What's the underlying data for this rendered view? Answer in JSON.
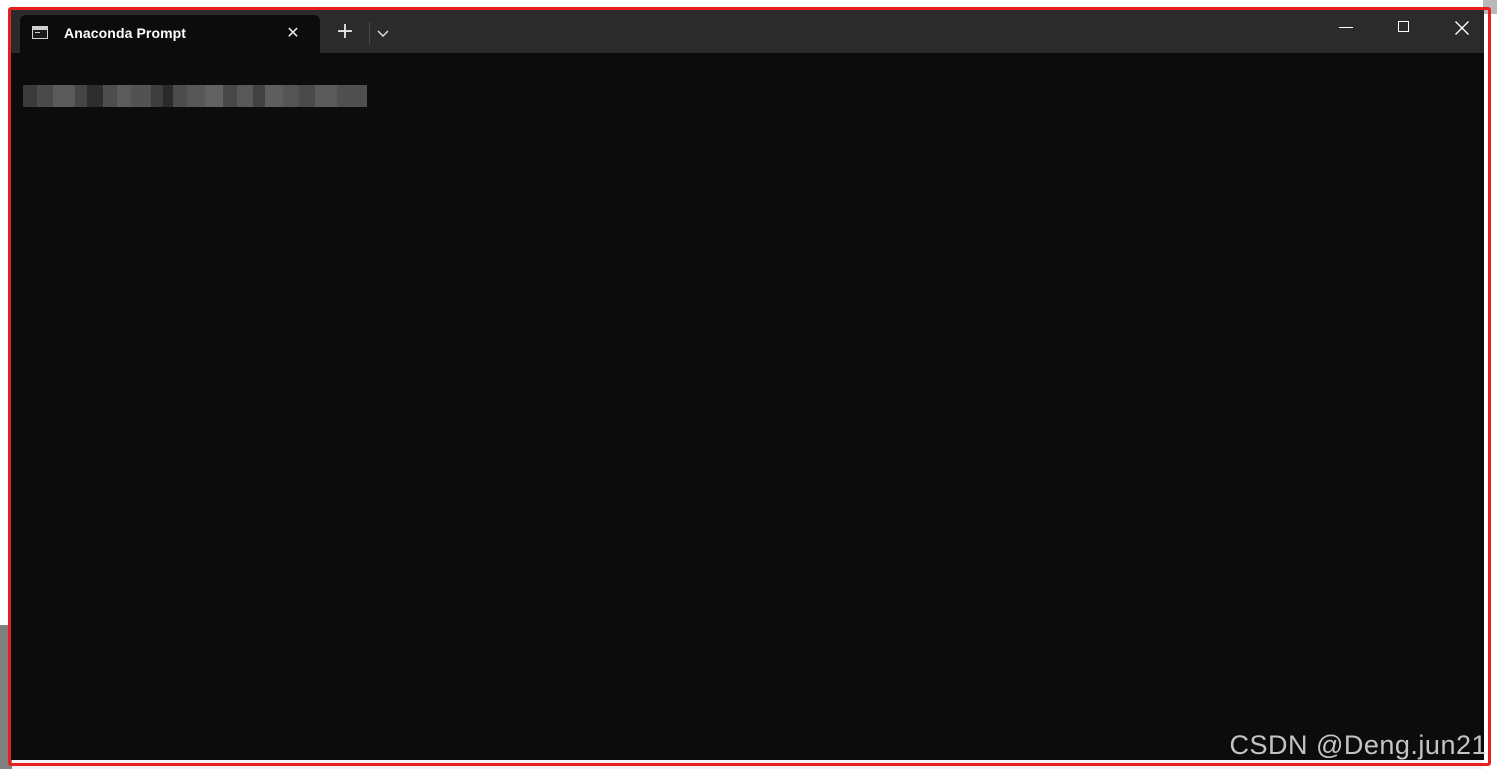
{
  "window": {
    "tab_title": "Anaconda Prompt",
    "tab_icon": "terminal-icon",
    "tab_close_icon": "close-icon",
    "new_tab_icon": "plus-icon",
    "dropdown_icon": "chevron-down-icon",
    "minimize_icon": "minimize-icon",
    "maximize_icon": "maximize-icon",
    "close_icon": "close-icon"
  },
  "terminal": {
    "content": "redacted",
    "background": "#0c0c0c"
  },
  "watermark": {
    "text": "CSDN @Deng.jun21"
  },
  "colors": {
    "highlight": "#e81f1f",
    "titlebar": "#2b2b2b",
    "tab_active": "#0c0c0c"
  }
}
